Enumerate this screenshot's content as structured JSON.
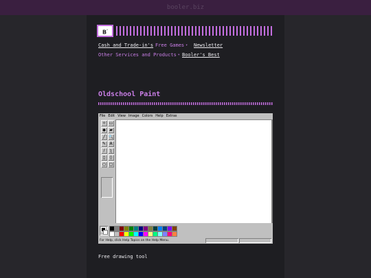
{
  "site": {
    "name": "booler.biz",
    "logo_text": "B"
  },
  "nav": {
    "items": [
      {
        "label": "Cash and Trade-in's"
      },
      {
        "label": "Free Games"
      },
      {
        "label": "Newsletter"
      },
      {
        "label": "Other Services and Products"
      },
      {
        "label": "Booler's Best"
      }
    ],
    "caret": "▾"
  },
  "page": {
    "title": "Oldschool Paint",
    "description": "Free drawing tool"
  },
  "paint": {
    "menu": [
      "File",
      "Edit",
      "View",
      "Image",
      "Colors",
      "Help",
      "Extras"
    ],
    "tools": [
      "✧",
      "▭",
      "◆",
      "▰",
      "╱",
      "🔍",
      "✎",
      "A",
      "∕",
      "ʅ",
      "▯",
      "◊",
      "○",
      "▢"
    ],
    "status": "For Help, click Help Topics on the Help Menu.",
    "palette": [
      "#000000",
      "#808080",
      "#800000",
      "#808000",
      "#008000",
      "#008080",
      "#000080",
      "#800080",
      "#808040",
      "#004040",
      "#0080ff",
      "#004080",
      "#8000ff",
      "#804000",
      "#ffffff",
      "#c0c0c0",
      "#ff0000",
      "#ffff00",
      "#00ff00",
      "#00ffff",
      "#0000ff",
      "#ff00ff",
      "#ffff80",
      "#00ff80",
      "#80ffff",
      "#8080ff",
      "#ff0080",
      "#ff8040"
    ]
  }
}
